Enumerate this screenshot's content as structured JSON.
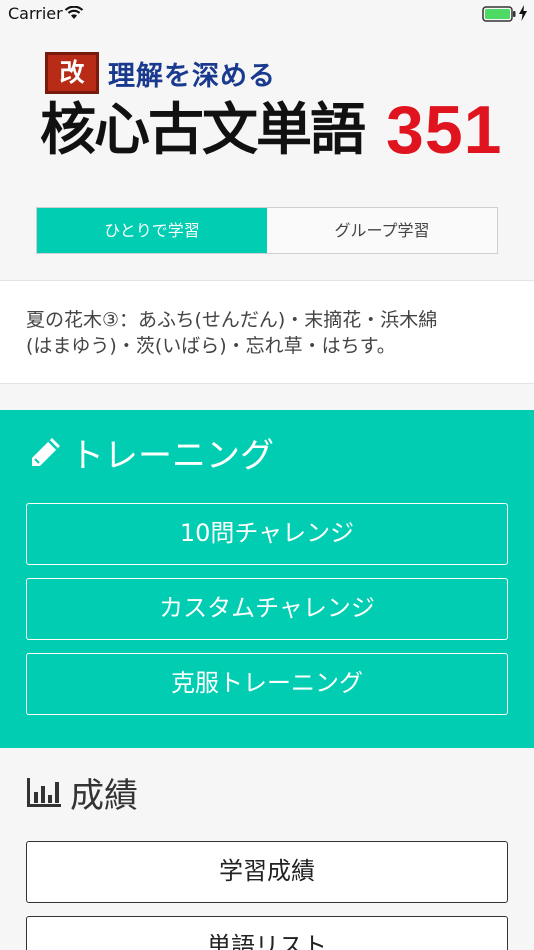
{
  "status_bar": {
    "carrier": "Carrier"
  },
  "logo": {
    "badge": "改",
    "subtitle": "理解を深める",
    "title": "核心古文単語",
    "number": "351"
  },
  "segments": [
    {
      "label": "ひとりで学習",
      "active": true
    },
    {
      "label": "グループ学習",
      "active": false
    }
  ],
  "notice": {
    "line1": "夏の花木③：あふち(せんだん)・末摘花・浜木綿",
    "line2": "(はまゆう)・茨(いばら)・忘れ草・はちす。"
  },
  "training": {
    "title": "トレーニング",
    "buttons": [
      "10問チャレンジ",
      "カスタムチャレンジ",
      "克服トレーニング"
    ]
  },
  "results": {
    "title": "成績",
    "buttons": [
      "学習成績",
      "単語リスト"
    ]
  },
  "colors": {
    "accent": "#00cdb1",
    "number_red": "#e0141e",
    "badge_red": "#b82c17",
    "subtitle_blue": "#1a3a8f"
  }
}
